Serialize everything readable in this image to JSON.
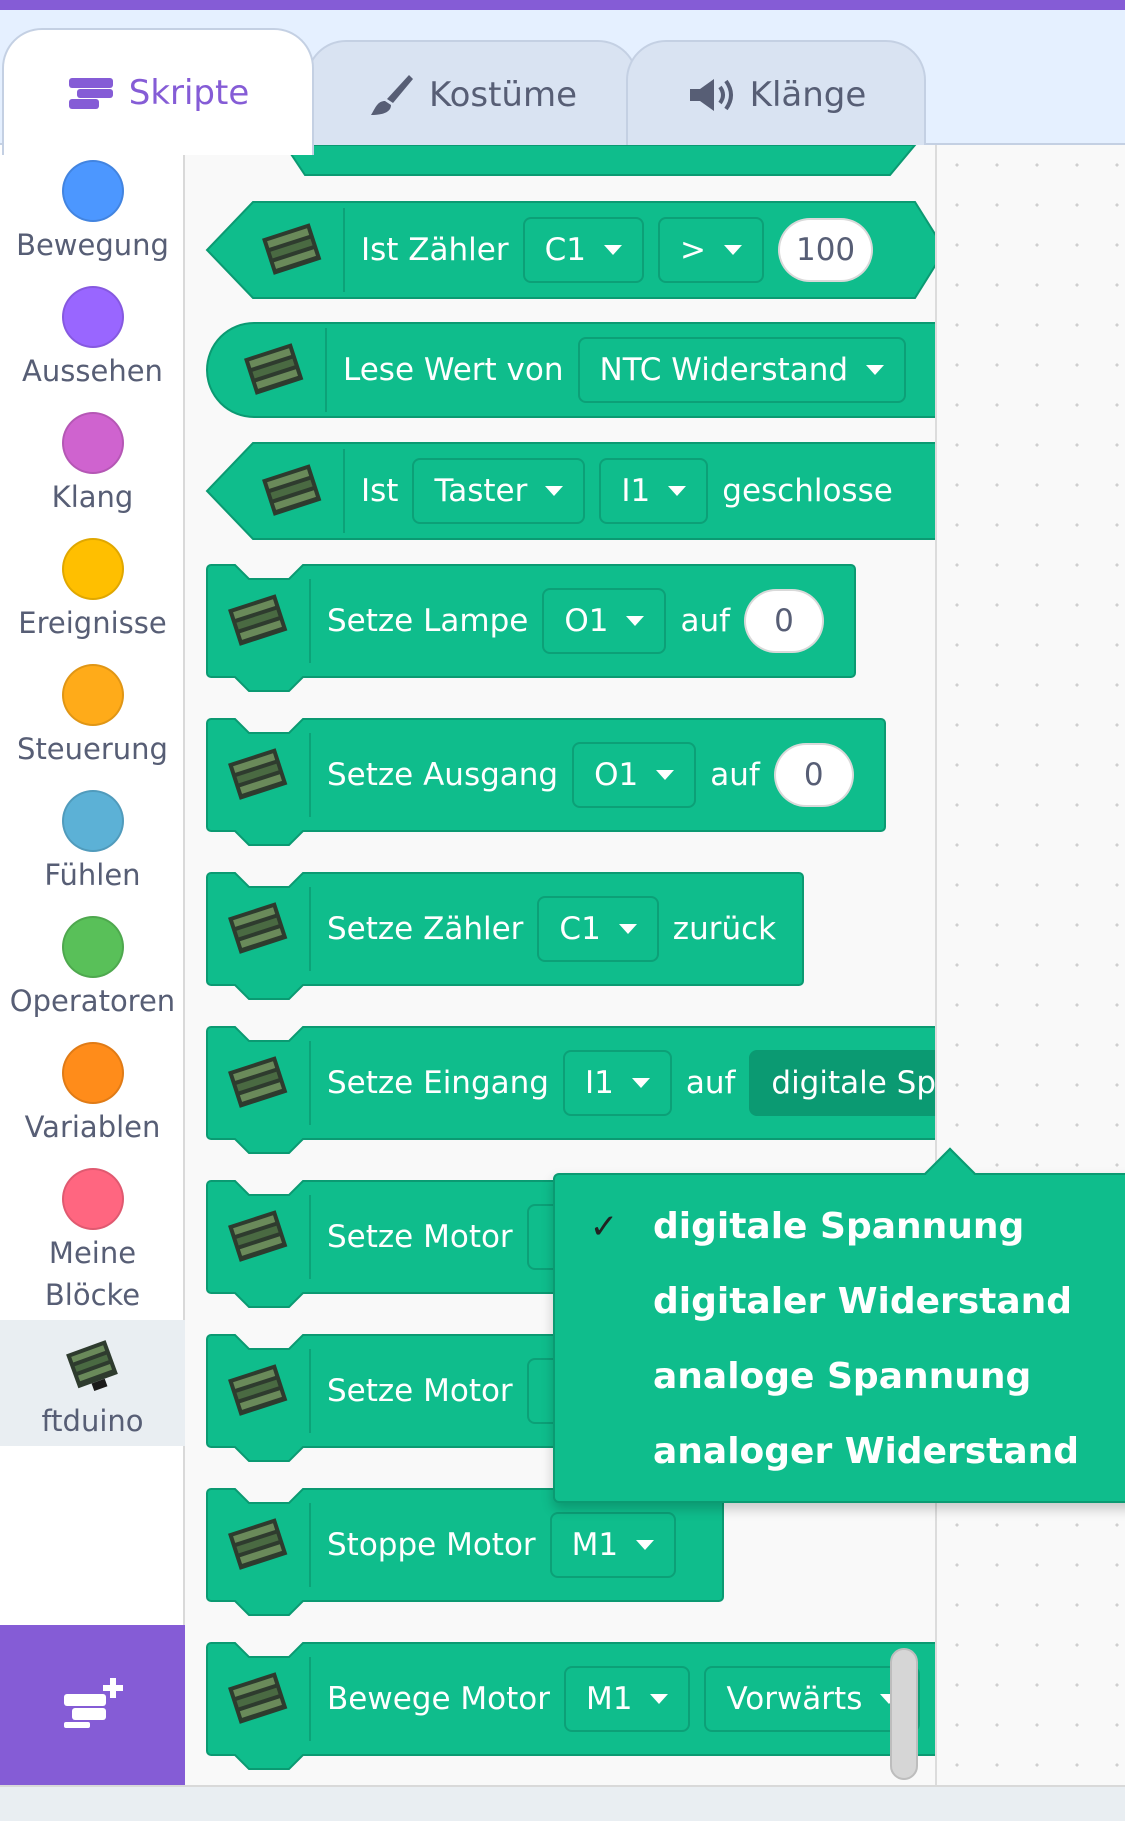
{
  "tabs": {
    "scripts": "Skripte",
    "costumes": "Kostüme",
    "sounds": "Klänge"
  },
  "categories": [
    {
      "label": "Bewegung",
      "color": "#4c97ff"
    },
    {
      "label": "Aussehen",
      "color": "#9966ff"
    },
    {
      "label": "Klang",
      "color": "#cf63cf"
    },
    {
      "label": "Ereignisse",
      "color": "#ffbf00"
    },
    {
      "label": "Steuerung",
      "color": "#ffab19"
    },
    {
      "label": "Fühlen",
      "color": "#5cb1d6"
    },
    {
      "label": "Operatoren",
      "color": "#59c059"
    },
    {
      "label": "Variablen",
      "color": "#ff8c1a"
    },
    {
      "label": "Meine Blöcke",
      "color": "#ff6680"
    }
  ],
  "extension_category": {
    "label": "ftduino"
  },
  "blocks": {
    "counter_compare": {
      "label": "Ist Zähler",
      "counter": "C1",
      "operator": ">",
      "value": "100"
    },
    "read_value": {
      "label": "Lese Wert von",
      "sensor": "NTC Widerstand"
    },
    "is_button": {
      "label": "Ist",
      "type": "Taster",
      "input": "I1",
      "state": "geschlosse"
    },
    "set_lamp": {
      "label": "Setze Lampe",
      "output": "O1",
      "word": "auf",
      "value": "0"
    },
    "set_output": {
      "label": "Setze Ausgang",
      "output": "O1",
      "word": "auf",
      "value": "0"
    },
    "reset_counter": {
      "label": "Setze Zähler",
      "counter": "C1",
      "word": "zurück"
    },
    "set_input": {
      "label": "Setze Eingang",
      "input": "I1",
      "word": "auf",
      "mode": "digitale Sp"
    },
    "set_motor_1": {
      "label": "Setze Motor"
    },
    "set_motor_2": {
      "label": "Setze Motor"
    },
    "stop_motor": {
      "label": "Stoppe Motor",
      "motor": "M1"
    },
    "move_motor": {
      "label": "Bewege Motor",
      "motor": "M1",
      "direction": "Vorwärts"
    }
  },
  "dropdown": {
    "options": [
      {
        "label": "digitale Spannung",
        "selected": true
      },
      {
        "label": "digitaler Widerstand",
        "selected": false
      },
      {
        "label": "analoge Spannung",
        "selected": false
      },
      {
        "label": "analoger Widerstand",
        "selected": false
      }
    ],
    "check_mark": "✓"
  },
  "colors": {
    "accent": "#855cd6",
    "block_green": "#0fbd8c",
    "block_border": "#0b9a72"
  }
}
